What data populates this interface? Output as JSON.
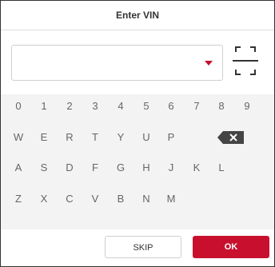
{
  "dialog": {
    "title": "Enter VIN"
  },
  "input": {
    "value": "",
    "dropdown_icon": "caret-down-icon"
  },
  "scan_icon": "scan-icon",
  "keyboard": {
    "row1": [
      "0",
      "1",
      "2",
      "3",
      "4",
      "5",
      "6",
      "7",
      "8",
      "9"
    ],
    "row2": [
      "W",
      "E",
      "R",
      "T",
      "Y",
      "U",
      "P"
    ],
    "row3": [
      "A",
      "S",
      "D",
      "F",
      "G",
      "H",
      "J",
      "K",
      "L"
    ],
    "row4": [
      "Z",
      "X",
      "C",
      "V",
      "B",
      "N",
      "M"
    ],
    "backspace_icon": "backspace-icon"
  },
  "buttons": {
    "skip": "SKIP",
    "ok": "OK"
  },
  "colors": {
    "accent": "#c8102e"
  }
}
